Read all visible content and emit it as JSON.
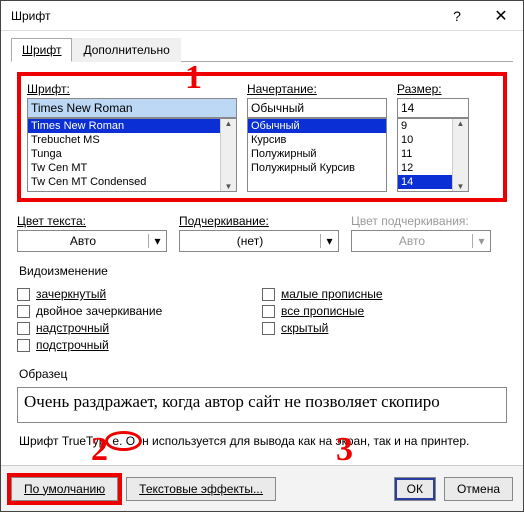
{
  "title": "Шрифт",
  "tabs": {
    "font": "Шрифт",
    "advanced": "Дополнительно"
  },
  "annotations": {
    "one": "1",
    "two": "2",
    "three": "3"
  },
  "font": {
    "label": "Шрифт:",
    "value": "Times New Roman",
    "list": [
      "Times New Roman",
      "Trebuchet MS",
      "Tunga",
      "Tw Cen MT",
      "Tw Cen MT Condensed"
    ]
  },
  "style": {
    "label": "Начертание:",
    "value": "Обычный",
    "list": [
      "Обычный",
      "Курсив",
      "Полужирный",
      "Полужирный Курсив"
    ]
  },
  "size": {
    "label": "Размер:",
    "value": "14",
    "list": [
      "9",
      "10",
      "11",
      "12",
      "14"
    ]
  },
  "color": {
    "label": "Цвет текста:",
    "value": "Авто"
  },
  "underline": {
    "label": "Подчеркивание:",
    "value": "(нет)"
  },
  "ucolor": {
    "label": "Цвет подчеркивания:",
    "value": "Авто"
  },
  "effects": {
    "title": "Видоизменение",
    "left": [
      "зачеркнутый",
      "двойное зачеркивание",
      "надстрочный",
      "подстрочный"
    ],
    "right": [
      "малые прописные",
      "все прописные",
      "скрытый"
    ]
  },
  "sample": {
    "title": "Образец",
    "text": "Очень раздражает, когда автор сайт не позволяет скопиро"
  },
  "hint": {
    "prefix": "Шрифт TrueTyp",
    "ellipse": "e. О",
    "suffix": "н используется для вывода как на экран, так и на принтер."
  },
  "buttons": {
    "default": "По умолчанию",
    "effects": "Текстовые эффекты...",
    "ok": "ОК",
    "cancel": "Отмена"
  }
}
